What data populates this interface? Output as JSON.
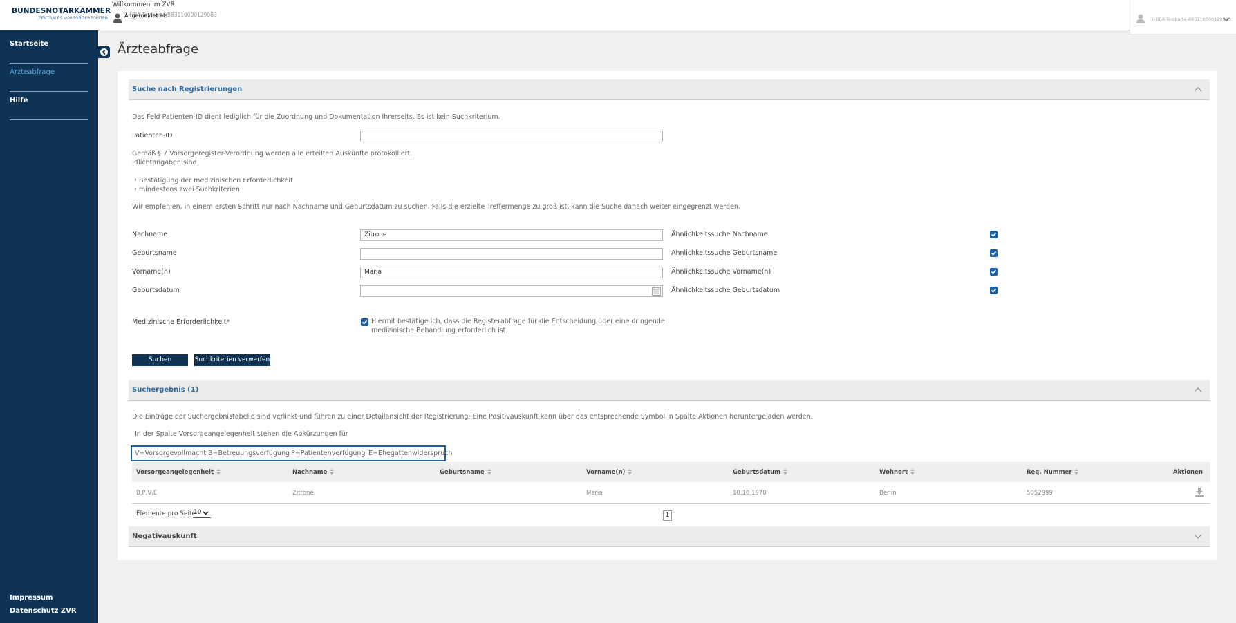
{
  "header": {
    "logo_main": "BUNDESNOTARKAMMER",
    "logo_sub": "ZENTRALES VORSORGEREGISTER",
    "welcome": "Willkommen im ZVR",
    "logged_in_label": "Angemeldet als",
    "logged_in_card": "1-HBA-Testkarte-883110000129083",
    "user_menu_text": "1-HBA-Testkarte-883110000129083"
  },
  "sidebar": {
    "items": [
      {
        "label": "Startseite",
        "active": false
      },
      {
        "label": "Ärzteabfrage",
        "active": true
      },
      {
        "label": "Hilfe",
        "active": false
      }
    ],
    "footer": [
      "Impressum",
      "Datenschutz ZVR"
    ]
  },
  "page": {
    "title": "Ärzteabfrage"
  },
  "search": {
    "section_title": "Suche nach Registrierungen",
    "intro": "Das Feld Patienten-ID dient lediglich für die Zuordnung und Dokumentation Ihrerseits. Es ist kein Suchkriterium.",
    "patient_id_label": "Patienten-ID",
    "patient_id_value": "",
    "protocol_note": "Gemäß § 7 Vorsorgeregister-Verordnung werden alle erteilten Auskünfte protokolliert.",
    "required_title": "Pflichtangaben sind",
    "required_items": [
      "· Bestätigung der medizinischen Erforderlichkeit",
      "· mindestens zwei Suchkriterien"
    ],
    "recommendation": "Wir empfehlen, in einem ersten Schritt nur nach Nachname und Geburtsdatum zu suchen. Falls die erzielte Treffermenge zu groß ist, kann die Suche danach weiter eingegrenzt werden.",
    "fields": [
      {
        "label": "Nachname",
        "value": "Zitrone",
        "similarity_label": "Ähnlichkeitssuche Nachname",
        "checked": true
      },
      {
        "label": "Geburtsname",
        "value": "",
        "similarity_label": "Ähnlichkeitssuche Geburtsname",
        "checked": true
      },
      {
        "label": "Vorname(n)",
        "value": "Maria",
        "similarity_label": "Ähnlichkeitssuche Vorname(n)",
        "checked": true
      },
      {
        "label": "Geburtsdatum",
        "value": "",
        "similarity_label": "Ähnlichkeitssuche Geburtsdatum",
        "checked": true
      }
    ],
    "medical_label": "Medizinische Erforderlichkeit*",
    "medical_confirm_line1": "Hiermit bestätige ich, dass die Registerabfrage für die Entscheidung über eine dringende",
    "medical_confirm_line2": "medizinische Behandlung erforderlich ist.",
    "search_button": "Suchen",
    "reset_button": "Suchkriterien verwerfen"
  },
  "results": {
    "section_title": "Suchergebnis (1)",
    "info": "Die Einträge der Suchergebnistabelle sind verlinkt und führen zu einer Detailansicht der Registrierung. Eine Positivauskunft kann über das entsprechende Symbol in Spalte Aktionen heruntergeladen werden.",
    "abbr_intro": "In der Spalte Vorsorgeangelegenheit stehen die Abkürzungen für",
    "legend": [
      "V=Vorsorgevollmacht",
      "B=Betreuungsverfügung",
      "P=Patientenverfügung",
      "E=Ehegattenwiderspruch"
    ],
    "columns": [
      "Vorsorgeangelegenheit",
      "Nachname",
      "Geburtsname",
      "Vorname(n)",
      "Geburtsdatum",
      "Wohnort",
      "Reg. Nummer",
      "Aktionen"
    ],
    "rows": [
      [
        "B,P,V,E",
        "Zitrone",
        "",
        "Maria",
        "10.10.1970",
        "Berlin",
        "5052999"
      ]
    ],
    "per_page_label": "Elemente pro Seite",
    "per_page_value": "10",
    "current_page": "1"
  },
  "negative": {
    "section_title": "Negativauskunft"
  },
  "colors": {
    "sidebar": "#0e3355",
    "accent": "#1c5fa0",
    "active_nav": "#4fa6e0"
  }
}
